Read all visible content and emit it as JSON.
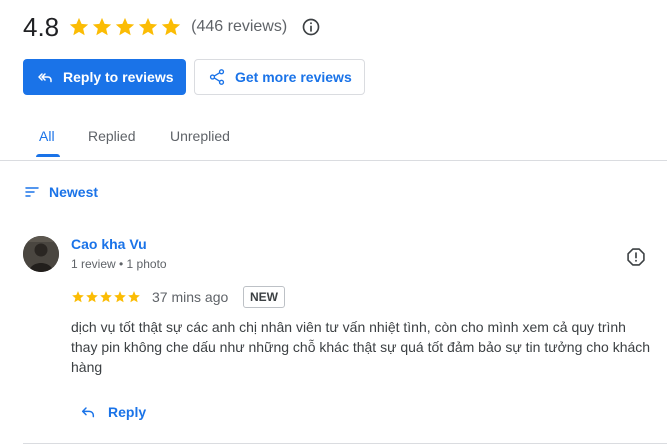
{
  "summary": {
    "rating": "4.8",
    "star_count": 5,
    "review_count": "(446 reviews)",
    "star_color": "#fbbc04"
  },
  "actions": {
    "reply_to_reviews": "Reply to reviews",
    "get_more_reviews": "Get more reviews"
  },
  "tabs": [
    {
      "label": "All",
      "active": true
    },
    {
      "label": "Replied",
      "active": false
    },
    {
      "label": "Unreplied",
      "active": false
    }
  ],
  "sort": {
    "label": "Newest"
  },
  "review": {
    "name": "Cao kha Vu",
    "meta": "1 review • 1 photo",
    "stars": 5,
    "time": "37 mins ago",
    "badge": "NEW",
    "text": "dịch vụ tốt thật sự các anh chị nhân viên tư vấn nhiệt tình, còn cho mình xem cả quy trình thay pin không che dấu như những chỗ khác thật sự quá tốt đảm bảo sự tin tưởng cho khách hàng",
    "reply_label": "Reply"
  },
  "colors": {
    "accent": "#1a73e8",
    "divider": "#dadce0",
    "secondary_text": "#5f6368"
  },
  "icons": [
    "star-icon",
    "info-icon",
    "reply-icon",
    "share-icon",
    "sort-icon",
    "flag-icon"
  ]
}
